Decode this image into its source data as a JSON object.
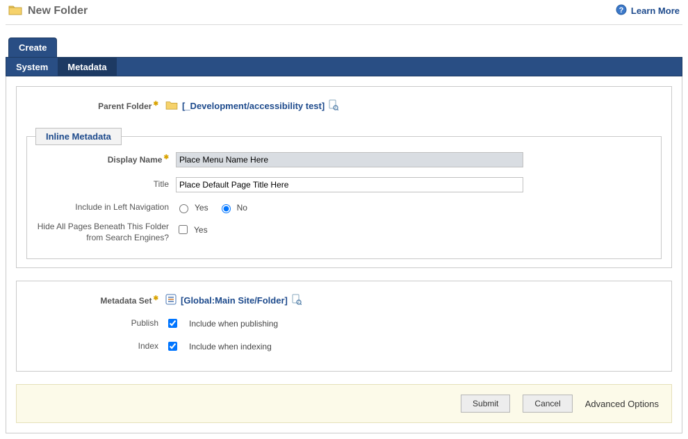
{
  "header": {
    "title": "New Folder",
    "learn_more": "Learn More"
  },
  "tabs": {
    "primary": "Create",
    "sub": [
      "System",
      "Metadata"
    ],
    "active_sub_index": 1
  },
  "parent_folder": {
    "label": "Parent Folder",
    "value": "[_Development/accessibility test]"
  },
  "inline_metadata": {
    "legend": "Inline Metadata",
    "display_name": {
      "label": "Display Name",
      "value": "Place Menu Name Here"
    },
    "title": {
      "label": "Title",
      "value": "Place Default Page Title Here"
    },
    "include_nav": {
      "label": "Include in Left Navigation",
      "yes": "Yes",
      "no": "No",
      "selected": "No"
    },
    "hide_search": {
      "label": "Hide All Pages Beneath This Folder from Search Engines?",
      "yes": "Yes",
      "checked": false
    }
  },
  "metadata_set": {
    "label": "Metadata Set",
    "value": "[Global:Main Site/Folder]",
    "publish": {
      "label": "Publish",
      "text": "Include when publishing",
      "checked": true
    },
    "index": {
      "label": "Index",
      "text": "Include when indexing",
      "checked": true
    }
  },
  "actions": {
    "submit": "Submit",
    "cancel": "Cancel",
    "advanced": "Advanced Options"
  }
}
